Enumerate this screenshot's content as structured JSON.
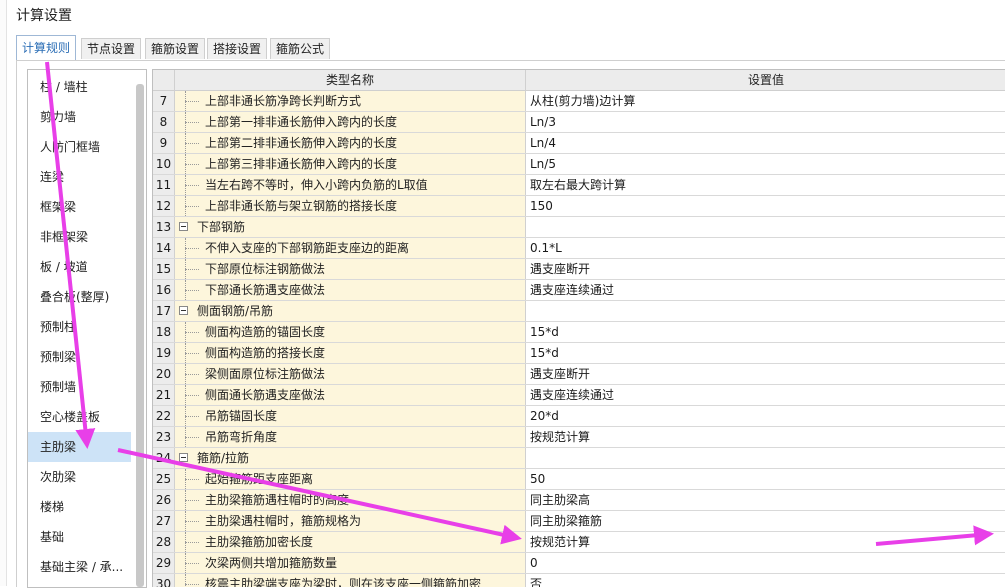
{
  "window": {
    "title": "计算设置"
  },
  "tabs": [
    {
      "label": "计算规则",
      "active": true
    },
    {
      "label": "节点设置",
      "active": false
    },
    {
      "label": "箍筋设置",
      "active": false
    },
    {
      "label": "搭接设置",
      "active": false
    },
    {
      "label": "箍筋公式",
      "active": false
    }
  ],
  "sidebar": {
    "items": [
      {
        "label": "柱 / 墙柱"
      },
      {
        "label": "剪力墙"
      },
      {
        "label": "人防门框墙"
      },
      {
        "label": "连梁"
      },
      {
        "label": "框架梁"
      },
      {
        "label": "非框架梁"
      },
      {
        "label": "板 / 坡道"
      },
      {
        "label": "叠合板(整厚)"
      },
      {
        "label": "预制柱"
      },
      {
        "label": "预制梁"
      },
      {
        "label": "预制墙"
      },
      {
        "label": "空心楼盖板"
      },
      {
        "label": "主肋梁",
        "selected": true
      },
      {
        "label": "次肋梁"
      },
      {
        "label": "楼梯"
      },
      {
        "label": "基础"
      },
      {
        "label": "基础主梁 / 承..."
      }
    ]
  },
  "table": {
    "headers": {
      "name": "类型名称",
      "value": "设置值"
    },
    "rows": [
      {
        "num": "7",
        "name": "上部非通长筋净跨长判断方式",
        "value": "从柱(剪力墙)边计算"
      },
      {
        "num": "8",
        "name": "上部第一排非通长筋伸入跨内的长度",
        "value": "Ln/3"
      },
      {
        "num": "9",
        "name": "上部第二排非通长筋伸入跨内的长度",
        "value": "Ln/4"
      },
      {
        "num": "10",
        "name": "上部第三排非通长筋伸入跨内的长度",
        "value": "Ln/5"
      },
      {
        "num": "11",
        "name": "当左右跨不等时，伸入小跨内负筋的L取值",
        "value": "取左右最大跨计算"
      },
      {
        "num": "12",
        "name": "上部非通长筋与架立钢筋的搭接长度",
        "value": "150"
      },
      {
        "num": "13",
        "name": "下部钢筋",
        "value": "",
        "group": true
      },
      {
        "num": "14",
        "name": "不伸入支座的下部钢筋距支座边的距离",
        "value": "0.1*L"
      },
      {
        "num": "15",
        "name": "下部原位标注钢筋做法",
        "value": "遇支座断开"
      },
      {
        "num": "16",
        "name": "下部通长筋遇支座做法",
        "value": "遇支座连续通过"
      },
      {
        "num": "17",
        "name": "侧面钢筋/吊筋",
        "value": "",
        "group": true
      },
      {
        "num": "18",
        "name": "侧面构造筋的锚固长度",
        "value": "15*d"
      },
      {
        "num": "19",
        "name": "侧面构造筋的搭接长度",
        "value": "15*d"
      },
      {
        "num": "20",
        "name": "梁侧面原位标注筋做法",
        "value": "遇支座断开"
      },
      {
        "num": "21",
        "name": "侧面通长筋遇支座做法",
        "value": "遇支座连续通过"
      },
      {
        "num": "22",
        "name": "吊筋锚固长度",
        "value": "20*d"
      },
      {
        "num": "23",
        "name": "吊筋弯折角度",
        "value": "按规范计算"
      },
      {
        "num": "24",
        "name": "箍筋/拉筋",
        "value": "",
        "group": true
      },
      {
        "num": "25",
        "name": "起始箍筋距支座距离",
        "value": "50"
      },
      {
        "num": "26",
        "name": "主肋梁箍筋遇柱帽时的高度",
        "value": "同主肋梁高"
      },
      {
        "num": "27",
        "name": "主肋梁遇柱帽时，箍筋规格为",
        "value": "同主肋梁箍筋"
      },
      {
        "num": "28",
        "name": "主肋梁箍筋加密长度",
        "value": "按规范计算"
      },
      {
        "num": "29",
        "name": "次梁两侧共增加箍筋数量",
        "value": "0"
      },
      {
        "num": "30",
        "name": "核震主肋梁端支座为梁时，则在该支座一侧箍筋加密",
        "value": "否"
      }
    ]
  },
  "annotations": {
    "arrow_color": "#e83fe8"
  }
}
